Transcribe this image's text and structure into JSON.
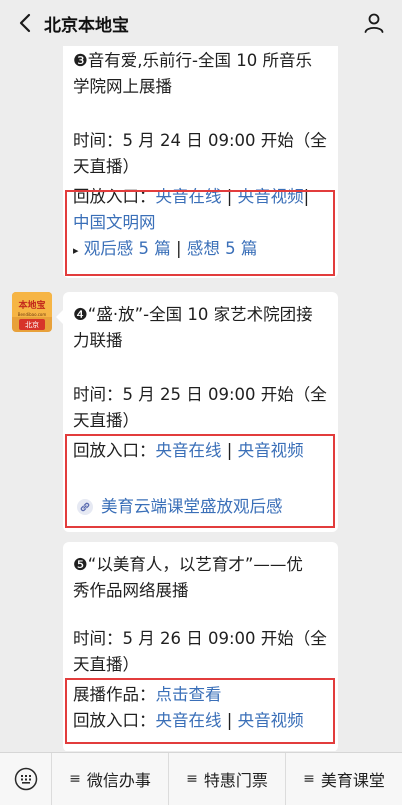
{
  "header": {
    "title": "北京本地宝"
  },
  "avatar": {
    "logo_text": "本地宝",
    "site_text": "Bendibao.com",
    "city_text": "北京"
  },
  "messages": [
    {
      "title_lines": [
        "❸音有爱,乐前行-全国 10 所音乐",
        "学院网上展播"
      ],
      "time_label": "时间：5 月 24 日 09:00 开始（全",
      "time_label2": "天直播）",
      "replay_label": "回放入口：",
      "replay_links": [
        "央音在线",
        "央音视频",
        "中国文明网"
      ],
      "sep": "|",
      "extra_prefix": "▸",
      "extra_links": [
        "观后感 5 篇",
        "感想 5 篇"
      ]
    },
    {
      "title_lines": [
        "❹“盛·放”-全国 10 家艺术院团接",
        "力联播"
      ],
      "time_label": "时间：5 月 25 日 09:00 开始（全",
      "time_label2": "天直播）",
      "replay_label": "回放入口：",
      "replay_links": [
        "央音在线",
        "央音视频"
      ],
      "sep": "|",
      "mini_link": "美育云端课堂盛放观后感"
    },
    {
      "title_lines": [
        "❺“以美育人，以艺育才”——优",
        "秀作品网络展播"
      ],
      "time_label": "时间：5 月 26 日 09:00 开始（全",
      "time_label2": "天直播）",
      "works_label": "展播作品：",
      "works_link": "点击查看",
      "replay_label": "回放入口：",
      "replay_links": [
        "央音在线",
        "央音视频"
      ],
      "sep": "|"
    }
  ],
  "bottom_menu": {
    "items": [
      "微信办事",
      "特惠门票",
      "美育课堂"
    ],
    "item_icon": "≡"
  },
  "colors": {
    "link": "#3a6fb8",
    "highlight_box": "#e23c3c",
    "bubble": "#ffffff",
    "background": "#ededed"
  }
}
